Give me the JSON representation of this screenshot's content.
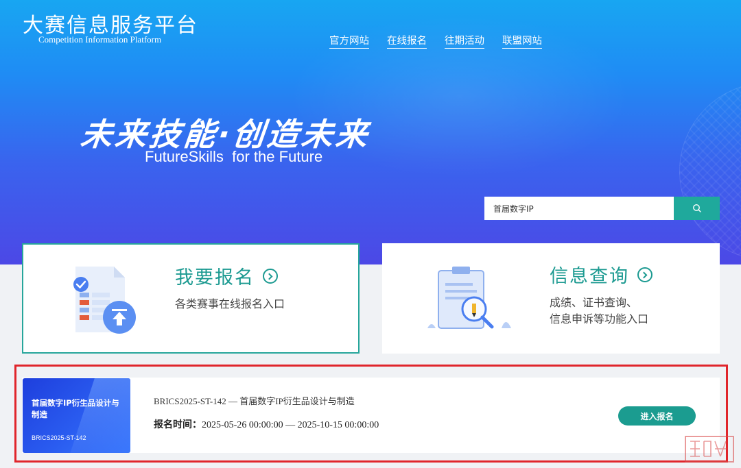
{
  "header": {
    "brand_title": "大赛信息服务平台",
    "brand_subtitle": "Competition Information Platform",
    "nav": [
      "官方网站",
      "在线报名",
      "往期活动",
      "联盟网站"
    ]
  },
  "hero": {
    "slogan_cn": "未来技能·创造未来",
    "slogan_en": "FutureSkills  for the Future"
  },
  "search": {
    "value": "首届数字IP",
    "icon": "search-icon"
  },
  "cards": {
    "register": {
      "title": "我要报名",
      "desc": "各类赛事在线报名入口"
    },
    "query": {
      "title": "信息查询",
      "desc_line1": "成绩、证书查询、",
      "desc_line2": "信息申诉等功能入口"
    }
  },
  "competition": {
    "thumb_title": "首届数字IP衍生品设计与制造",
    "thumb_code": "BRICS2025-ST-142",
    "title": "BRICS2025-ST-142 — 首届数字IP衍生品设计与制造",
    "time_label": "报名时间：",
    "time_range": "2025-05-26 00:00:00 — 2025-10-15 00:00:00",
    "enter_label": "进入报名"
  },
  "colors": {
    "accent_teal": "#1c9a91",
    "highlight_red": "#e0252b",
    "hero_blue": "#1f8cf4"
  }
}
